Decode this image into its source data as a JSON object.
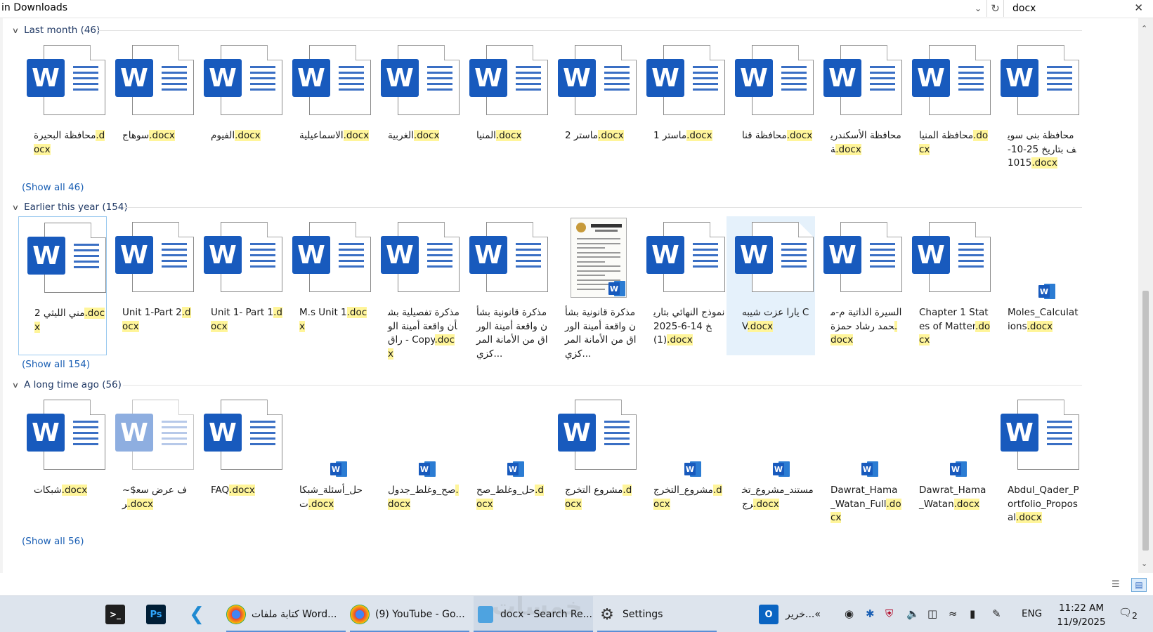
{
  "address": {
    "path": "in Downloads",
    "search_value": "docx"
  },
  "groups": [
    {
      "header": "Last month (46)",
      "show_all": "(Show all 46)",
      "items": [
        {
          "pre": "محافظة البحيرة",
          "ext": ".docx",
          "icon": "word"
        },
        {
          "pre": "سوهاج",
          "ext": ".docx",
          "icon": "word"
        },
        {
          "pre": "الفيوم",
          "ext": ".docx",
          "icon": "word"
        },
        {
          "pre": "الاسماعيلية",
          "ext": ".docx",
          "icon": "word"
        },
        {
          "pre": "الغربية",
          "ext": ".docx",
          "icon": "word"
        },
        {
          "pre": "المنيا",
          "ext": ".docx",
          "icon": "word"
        },
        {
          "pre": "ماستر 2",
          "ext": ".docx",
          "icon": "word"
        },
        {
          "pre": "ماستر 1",
          "ext": ".docx",
          "icon": "word"
        },
        {
          "pre": "محافظة قنا",
          "ext": ".docx",
          "icon": "word"
        },
        {
          "pre": "محافظة الأسكندرية",
          "ext": ".docx",
          "icon": "word"
        },
        {
          "pre": "محافظة المنيا",
          "ext": ".docx",
          "icon": "word"
        },
        {
          "pre": "محافظة بنى سويف بتاريخ 25-10-1015",
          "ext": ".docx",
          "icon": "word"
        }
      ]
    },
    {
      "header": "Earlier this year (154)",
      "show_all": "(Show all 154)",
      "items": [
        {
          "pre": "مني الليثي 2",
          "ext": ".docx",
          "icon": "word",
          "state": "outline"
        },
        {
          "pre": "Unit 1-Part 2",
          "ext": ".docx",
          "icon": "word"
        },
        {
          "pre": "Unit 1- Part 1",
          "ext": ".docx",
          "icon": "word"
        },
        {
          "pre": "M.s Unit 1",
          "ext": ".docx",
          "icon": "word"
        },
        {
          "pre": "مذكرة تفصيلية بشأن واقعة أمينة الوراق - Copy",
          "ext": ".docx",
          "icon": "word"
        },
        {
          "pre": "مذكرة قانونية بشأن واقعة أمينة الوراق من الأمانة المركزي...",
          "ext": "",
          "icon": "word"
        },
        {
          "pre": "مذكرة قانونية بشأن واقعة أمينة الوراق من الأمانة المركزي...",
          "ext": "",
          "icon": "scan"
        },
        {
          "pre": "نموذج النهائي بتاريخ 14-6-2025 (1)",
          "ext": ".docx",
          "icon": "word"
        },
        {
          "pre": "يارا عزت شيبه CV",
          "ext": ".docx",
          "icon": "word",
          "state": "hover"
        },
        {
          "pre": "السيرة الذاتية م-محمد رشاد حمزة",
          "ext": ".docx",
          "icon": "word"
        },
        {
          "pre": "Chapter 1 States of Matter",
          "ext": ".docx",
          "icon": "word"
        },
        {
          "pre": "Moles_Calculations",
          "ext": ".docx",
          "icon": "small"
        }
      ]
    },
    {
      "header": "A long time ago (56)",
      "show_all": "(Show all 56)",
      "items": [
        {
          "pre": "شبكات",
          "ext": ".docx",
          "icon": "word"
        },
        {
          "pre": "~$ف عرض سعر",
          "ext": ".docx",
          "icon": "word-faded"
        },
        {
          "pre": "FAQ",
          "ext": ".docx",
          "icon": "word"
        },
        {
          "pre": "حل_أسئلة_شبكات",
          "ext": ".docx",
          "icon": "small"
        },
        {
          "pre": "صح_وغلط_جدول",
          "ext": ".docx",
          "icon": "small"
        },
        {
          "pre": "حل_وغلط_صح",
          "ext": ".docx",
          "icon": "small"
        },
        {
          "pre": "مشروع التخرج",
          "ext": ".docx",
          "icon": "word"
        },
        {
          "pre": "مشروع_التخرج",
          "ext": ".docx",
          "icon": "small"
        },
        {
          "pre": "مستند_مشروع_تخرج",
          "ext": ".docx",
          "icon": "small"
        },
        {
          "pre": "Dawrat_Hama_Watan_Full",
          "ext": ".docx",
          "icon": "small"
        },
        {
          "pre": "Dawrat_Hama_Watan",
          "ext": ".docx",
          "icon": "small"
        },
        {
          "pre": "Abdul_Qader_Portfolio_Proposal",
          "ext": ".docx",
          "icon": "word"
        }
      ]
    }
  ],
  "taskbar": {
    "apps": [
      {
        "name": "terminal-button",
        "label": ""
      },
      {
        "name": "photoshop-button",
        "label": "Ps"
      },
      {
        "name": "vscode-button",
        "label": ""
      },
      {
        "name": "chrome-window-word",
        "label": "كتابة ملفات Word..."
      },
      {
        "name": "chrome-window-youtube",
        "label": "(9) YouTube - Go..."
      },
      {
        "name": "explorer-window",
        "label": "docx - Search Re..."
      },
      {
        "name": "settings-window",
        "label": "Settings"
      },
      {
        "name": "outlook-window",
        "label": "خرير...«"
      }
    ],
    "lang": "ENG",
    "time": "11:22 AM",
    "date": "11/9/2025",
    "notifications": "2"
  },
  "colors": {
    "accent": "#185abd",
    "highlight": "#fff59a",
    "link": "#1a5fb4",
    "taskbar": "#dde4ed"
  }
}
